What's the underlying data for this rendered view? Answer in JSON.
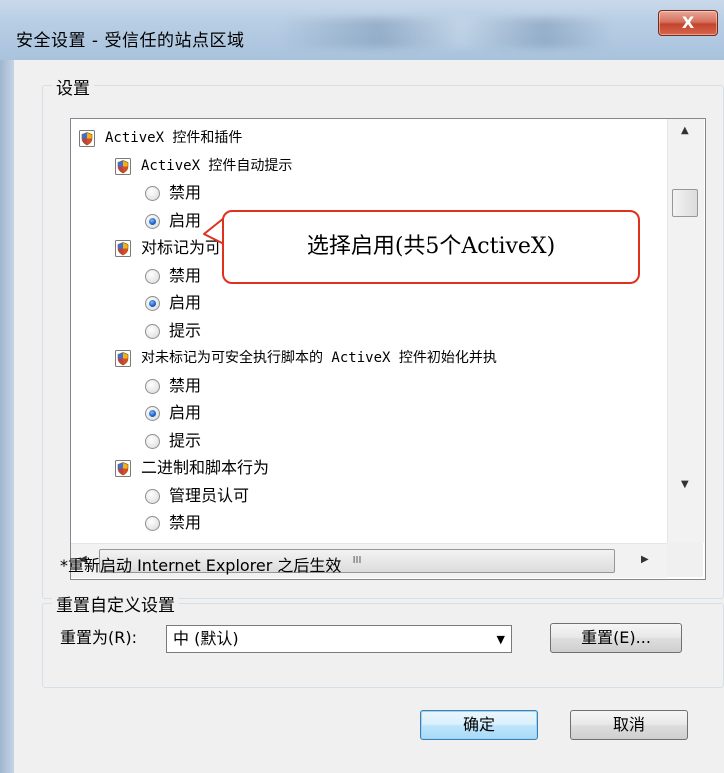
{
  "window": {
    "title": "安全设置 - 受信任的站点区域",
    "close_label": "X"
  },
  "settings_group": {
    "label": "设置",
    "items": [
      {
        "kind": "header",
        "text": "ActiveX 控件和插件",
        "mono": true
      },
      {
        "kind": "setting",
        "text": "ActiveX 控件自动提示",
        "mono": true
      },
      {
        "kind": "option",
        "text": "禁用",
        "selected": false
      },
      {
        "kind": "option",
        "text": "启用",
        "selected": true
      },
      {
        "kind": "setting",
        "text": "对标记为可安全执行脚本的 ActiveX 控件执行脚本",
        "mono": false
      },
      {
        "kind": "option",
        "text": "禁用",
        "selected": false
      },
      {
        "kind": "option",
        "text": "启用",
        "selected": true
      },
      {
        "kind": "option",
        "text": "提示",
        "selected": false
      },
      {
        "kind": "setting",
        "text": "对未标记为可安全执行脚本的 ActiveX 控件初始化并执",
        "mono": true
      },
      {
        "kind": "option",
        "text": "禁用",
        "selected": false
      },
      {
        "kind": "option",
        "text": "启用",
        "selected": true
      },
      {
        "kind": "option",
        "text": "提示",
        "selected": false
      },
      {
        "kind": "setting",
        "text": "二进制和脚本行为",
        "mono": false
      },
      {
        "kind": "option",
        "text": "管理员认可",
        "selected": false
      },
      {
        "kind": "option",
        "text": "禁用",
        "selected": false
      }
    ],
    "hscroll_grip": "III"
  },
  "note": "*重新启动 Internet Explorer 之后生效",
  "reset_group": {
    "label": "重置自定义设置",
    "reset_to_label": "重置为(R):",
    "reset_level": "中 (默认)",
    "reset_button": "重置(E)..."
  },
  "buttons": {
    "ok": "确定",
    "cancel": "取消"
  },
  "callout": {
    "text": "选择启用(共5个ActiveX)",
    "border_color": "#e0301e"
  }
}
